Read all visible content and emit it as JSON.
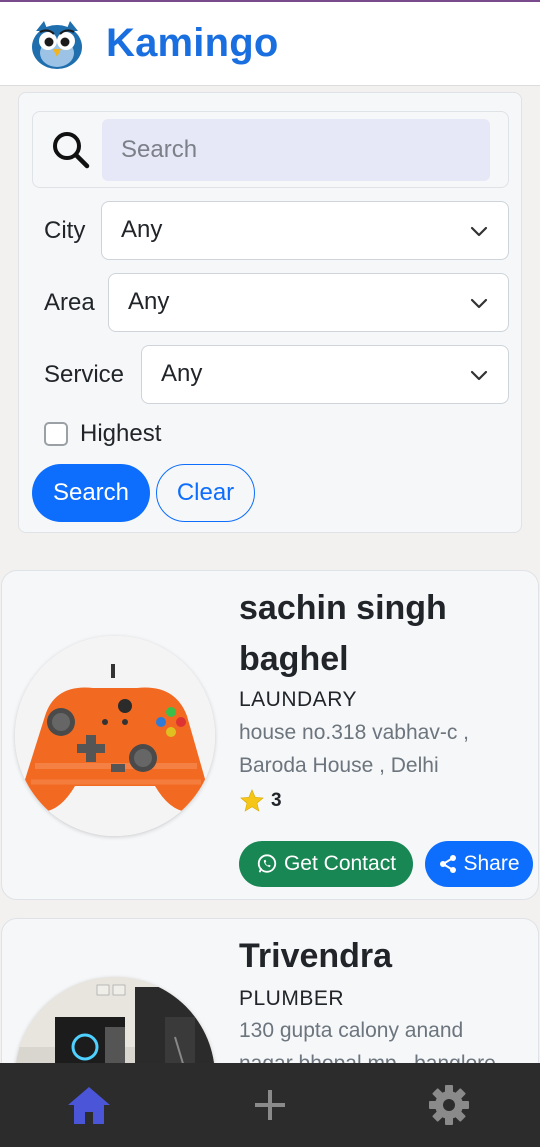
{
  "app": {
    "title": "Kamingo",
    "logo_icon": "owl-logo-icon",
    "accent_color": "#1a6fe0"
  },
  "filters": {
    "search_placeholder": "Search",
    "search_value": "",
    "city_label": "City",
    "city_value": "Any",
    "area_label": "Area",
    "area_value": "Any",
    "service_label": "Service",
    "service_value": "Any",
    "highest_label": "Highest",
    "highest_checked": false,
    "search_button": "Search",
    "clear_button": "Clear"
  },
  "listings": [
    {
      "name_line1": "sachin singh",
      "name_line2": "baghel",
      "category": "LAUNDARY",
      "address_line1": "house no.318 vabhav-c ,",
      "address_line2": "Baroda House , Delhi",
      "rating": "3",
      "image": "orange-game-controller",
      "contact_button": "Get Contact",
      "share_button": "Share"
    },
    {
      "name_line1": "Trivendra",
      "category": "PLUMBER",
      "address_line1": "130 gupta calony anand",
      "address_line2": "nagar bhopal mp , banglore",
      "image": "pc-setup-photo"
    }
  ],
  "bottom_nav": {
    "items": [
      "home-icon",
      "add-icon",
      "settings-icon"
    ],
    "active": "home-icon",
    "active_color": "#4a55d8"
  }
}
